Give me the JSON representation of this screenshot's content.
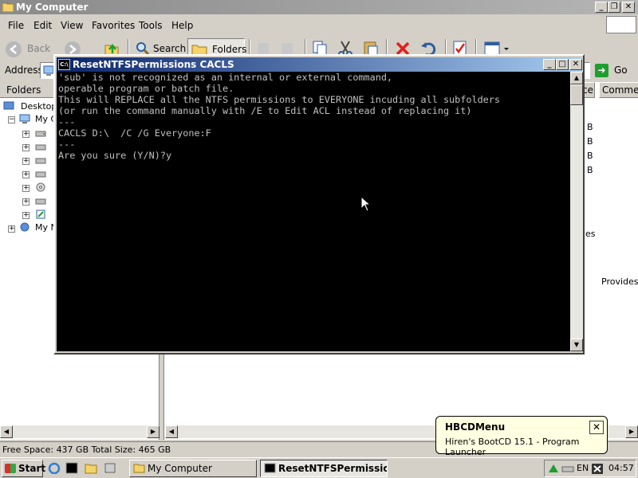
{
  "explorer": {
    "title": "My Computer",
    "menu": [
      "File",
      "Edit",
      "View",
      "Favorites",
      "Tools",
      "Help"
    ],
    "toolbar": {
      "back_label": "Back",
      "search_label": "Search",
      "folders_label": "Folders"
    },
    "address": {
      "label": "Address",
      "go_label": "Go"
    },
    "folders_pane": {
      "header": "Folders",
      "items": [
        "Desktop",
        "My C",
        "My N"
      ]
    },
    "list_columns": [
      "ce",
      "Comment"
    ],
    "list_fragments": [
      "B",
      "B",
      "B",
      "B",
      "es",
      "Provides"
    ],
    "status": "Free Space: 437 GB Total Size: 465 GB"
  },
  "console": {
    "title": "ResetNTFSPermissions CACLS",
    "lines": [
      "'sub' is not recognized as an internal or external command,",
      "operable program or batch file.",
      "This will REPLACE all the NTFS permissions to EVERYONE incuding all subfolders",
      "(or run the command manually with /E to Edit ACL instead of replacing it)",
      "---",
      "CACLS D:\\  /C /G Everyone:F",
      "---",
      "Are you sure (Y/N)?y"
    ]
  },
  "balloon": {
    "title": "HBCDMenu",
    "text": "Hiren's BootCD 15.1 - Program Launcher"
  },
  "taskbar": {
    "start_label": "Start",
    "tasks": [
      "My Computer",
      "ResetNTFSPermissio..."
    ],
    "language": "EN",
    "clock": "04:57"
  },
  "colors": {
    "console_bg": "#000000",
    "console_fg": "#c0c0c0",
    "active_title_start": "#0a246a",
    "active_title_end": "#a6caf0",
    "balloon_bg": "#ffffe1"
  }
}
